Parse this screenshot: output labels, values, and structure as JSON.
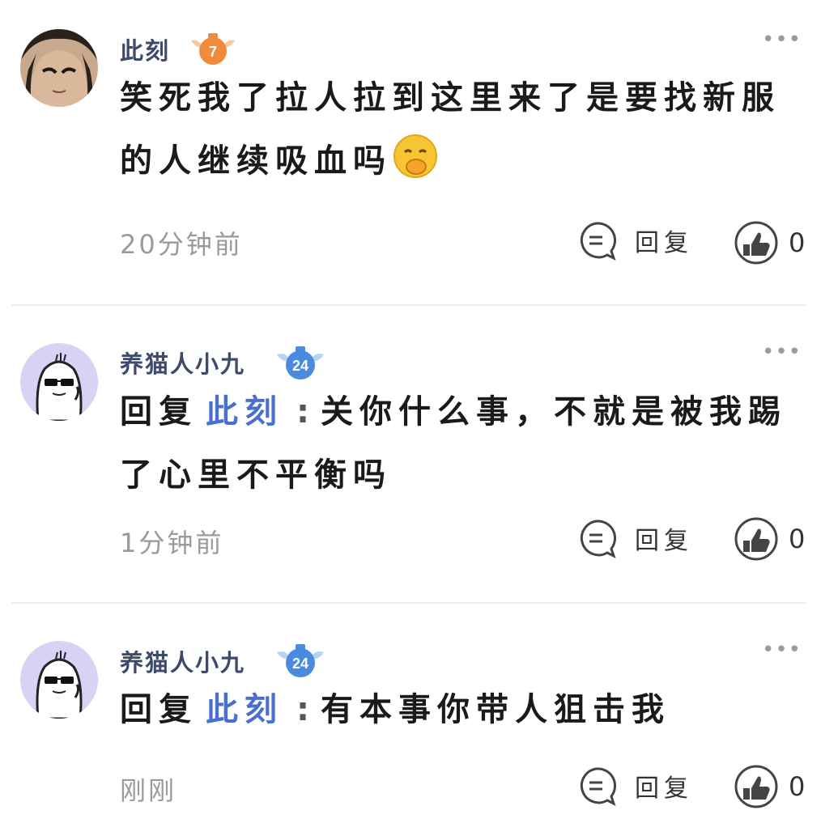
{
  "comments": [
    {
      "username": "此刻",
      "level": "7",
      "body": "笑死我了拉人拉到这里来了是要找新服的人继续吸血吗",
      "emoji": "smirk-emoji",
      "time": "20分钟前",
      "reply_label": "回复",
      "likes": "0",
      "more": "•••"
    },
    {
      "username": "养猫人小九",
      "level": "24",
      "reply_prefix": "回复",
      "mention": "此刻",
      "separator": ":",
      "body": "关你什么事，不就是被我踢了心里不平衡吗",
      "time": "1分钟前",
      "reply_label": "回复",
      "likes": "0",
      "more": "•••"
    },
    {
      "username": "养猫人小九",
      "level": "24",
      "reply_prefix": "回复",
      "mention": "此刻",
      "separator": ":",
      "body": "有本事你带人狙击我",
      "time": "刚刚",
      "reply_label": "回复",
      "likes": "0",
      "more": "•••"
    }
  ],
  "colors": {
    "mention": "#4a6fd1",
    "username": "#3d4a6b",
    "badge_orange": "#f08a3c",
    "badge_blue": "#4a8be0",
    "avatar_lavender": "#d8d3f5"
  }
}
